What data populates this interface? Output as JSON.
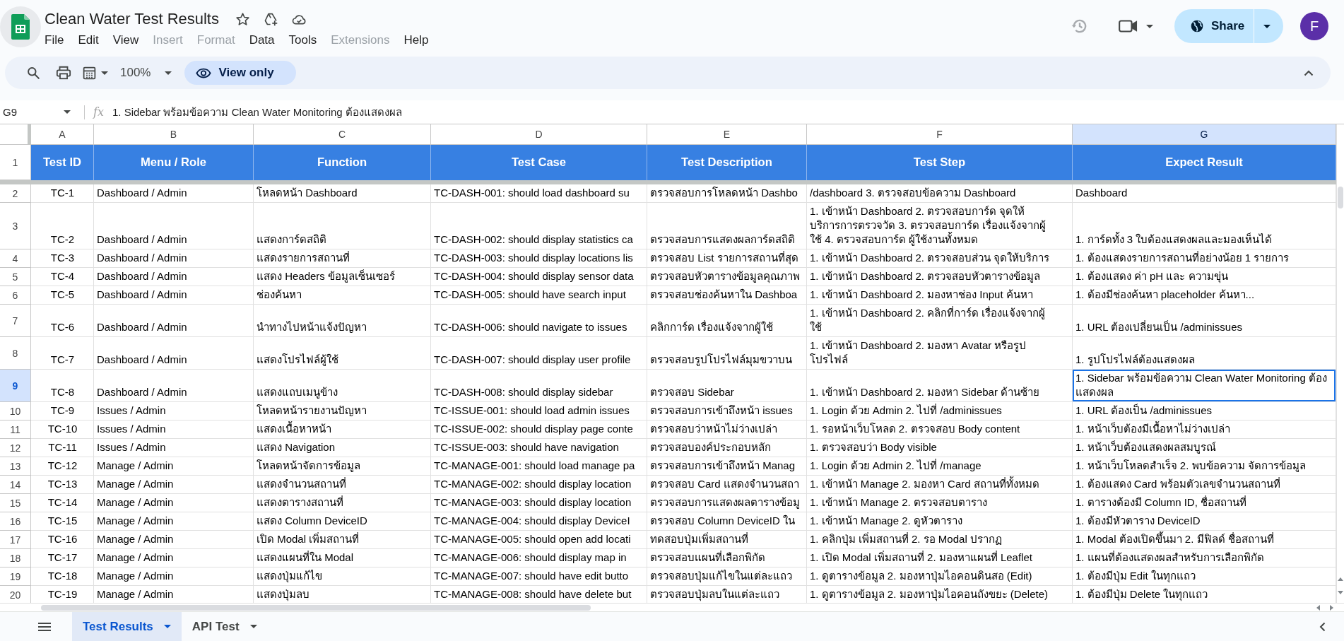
{
  "document": {
    "title": "Clean Water Test Results"
  },
  "menu": [
    {
      "label": "File",
      "disabled": false
    },
    {
      "label": "Edit",
      "disabled": false
    },
    {
      "label": "View",
      "disabled": false
    },
    {
      "label": "Insert",
      "disabled": true
    },
    {
      "label": "Format",
      "disabled": true
    },
    {
      "label": "Data",
      "disabled": false
    },
    {
      "label": "Tools",
      "disabled": false
    },
    {
      "label": "Extensions",
      "disabled": true
    },
    {
      "label": "Help",
      "disabled": false
    }
  ],
  "account": {
    "share_label": "Share",
    "avatar_initial": "F"
  },
  "toolbar": {
    "zoom": "100%",
    "mode": "View only"
  },
  "formula_bar": {
    "cell_ref": "G9",
    "fx": "fx",
    "content": "1. Sidebar พร้อมข้อความ Clean Water Monitoring ต้องแสดงผล"
  },
  "sheet": {
    "column_letters": [
      {
        "label": "A",
        "selected": false
      },
      {
        "label": "B",
        "selected": false
      },
      {
        "label": "C",
        "selected": false
      },
      {
        "label": "D",
        "selected": false
      },
      {
        "label": "E",
        "selected": false
      },
      {
        "label": "F",
        "selected": false
      },
      {
        "label": "G",
        "selected": true
      }
    ],
    "header_row": {
      "number": "1",
      "cells": [
        "Test ID",
        "Menu / Role",
        "Function",
        "Test Case",
        "Test Description",
        "Test Step",
        "Expect Result"
      ]
    },
    "rows": [
      {
        "number": "2",
        "selected": false,
        "cells": [
          {
            "text": "TC-1",
            "selected": false
          },
          {
            "text": "Dashboard / Admin",
            "selected": false
          },
          {
            "text": "โหลดหน้า Dashboard",
            "selected": false
          },
          {
            "text": "TC-DASH-001: should load dashboard su",
            "selected": false
          },
          {
            "text": "ตรวจสอบการโหลดหน้า Dashbo",
            "selected": false
          },
          {
            "text": "/dashboard 3. ตรวจสอบข้อความ Dashboard",
            "selected": false
          },
          {
            "text": "Dashboard",
            "selected": false
          }
        ]
      },
      {
        "number": "3",
        "selected": false,
        "cells": [
          {
            "text": "TC-2",
            "selected": false
          },
          {
            "text": "Dashboard / Admin",
            "selected": false
          },
          {
            "text": "แสดงการ์ดสถิติ",
            "selected": false
          },
          {
            "text": "TC-DASH-002: should display statistics ca",
            "selected": false
          },
          {
            "text": "ตรวจสอบการแสดงผลการ์ดสถิติ",
            "selected": false
          },
          {
            "text": "1. เข้าหน้า Dashboard 2. ตรวจสอบการ์ด จุดให้บริการการตรวจวัด 3. ตรวจสอบการ์ด เรื่องแจ้งจากผู้ใช้ 4. ตรวจสอบการ์ด ผู้ใช้งานทั้งหมด",
            "selected": false
          },
          {
            "text": "1. การ์ดทั้ง 3 ใบต้องแสดงผลและมองเห็นได้",
            "selected": false
          }
        ]
      },
      {
        "number": "4",
        "selected": false,
        "cells": [
          {
            "text": "TC-3",
            "selected": false
          },
          {
            "text": "Dashboard / Admin",
            "selected": false
          },
          {
            "text": "แสดงรายการสถานที่",
            "selected": false
          },
          {
            "text": "TC-DASH-003: should display locations lis",
            "selected": false
          },
          {
            "text": "ตรวจสอบ List รายการสถานที่สุด",
            "selected": false
          },
          {
            "text": "1. เข้าหน้า Dashboard 2. ตรวจสอบส่วน จุดให้บริการ",
            "selected": false
          },
          {
            "text": "1. ต้องแสดงรายการสถานที่อย่างน้อย 1 รายการ",
            "selected": false
          }
        ]
      },
      {
        "number": "5",
        "selected": false,
        "cells": [
          {
            "text": "TC-4",
            "selected": false
          },
          {
            "text": "Dashboard / Admin",
            "selected": false
          },
          {
            "text": "แสดง Headers ข้อมูลเซ็นเซอร์",
            "selected": false
          },
          {
            "text": "TC-DASH-004: should display sensor data",
            "selected": false
          },
          {
            "text": "ตรวจสอบหัวตารางข้อมูลคุณภาพ",
            "selected": false
          },
          {
            "text": "1. เข้าหน้า Dashboard 2. ตรวจสอบหัวตารางข้อมูล",
            "selected": false
          },
          {
            "text": "1. ต้องแสดง ค่า pH และ ความขุ่น",
            "selected": false
          }
        ]
      },
      {
        "number": "6",
        "selected": false,
        "cells": [
          {
            "text": "TC-5",
            "selected": false
          },
          {
            "text": "Dashboard / Admin",
            "selected": false
          },
          {
            "text": "ช่องค้นหา",
            "selected": false
          },
          {
            "text": "TC-DASH-005: should have search input",
            "selected": false
          },
          {
            "text": "ตรวจสอบช่องค้นหาใน Dashboa",
            "selected": false
          },
          {
            "text": "1. เข้าหน้า Dashboard 2. มองหาช่อง Input ค้นหา",
            "selected": false
          },
          {
            "text": "1. ต้องมีช่องค้นหา placeholder ค้นหา...",
            "selected": false
          }
        ]
      },
      {
        "number": "7",
        "selected": false,
        "cells": [
          {
            "text": "TC-6",
            "selected": false
          },
          {
            "text": "Dashboard / Admin",
            "selected": false
          },
          {
            "text": "นำทางไปหน้าแจ้งปัญหา",
            "selected": false
          },
          {
            "text": "TC-DASH-006: should navigate to issues",
            "selected": false
          },
          {
            "text": "คลิกการ์ด เรื่องแจ้งจากผู้ใช้",
            "selected": false
          },
          {
            "text": "1. เข้าหน้า Dashboard 2. คลิกที่การ์ด เรื่องแจ้งจากผู้ใช้",
            "selected": false
          },
          {
            "text": "1. URL ต้องเปลี่ยนเป็น /adminissues",
            "selected": false
          }
        ]
      },
      {
        "number": "8",
        "selected": false,
        "cells": [
          {
            "text": "TC-7",
            "selected": false
          },
          {
            "text": "Dashboard / Admin",
            "selected": false
          },
          {
            "text": "แสดงโปรไฟล์ผู้ใช้",
            "selected": false
          },
          {
            "text": "TC-DASH-007: should display user profile",
            "selected": false
          },
          {
            "text": "ตรวจสอบรูปโปรไฟล์มุมขวาบน",
            "selected": false
          },
          {
            "text": "1. เข้าหน้า Dashboard 2. มองหา Avatar หรือรูปโปรไฟล์",
            "selected": false
          },
          {
            "text": "1. รูปโปรไฟล์ต้องแสดงผล",
            "selected": false
          }
        ]
      },
      {
        "number": "9",
        "selected": true,
        "cells": [
          {
            "text": "TC-8",
            "selected": false
          },
          {
            "text": "Dashboard / Admin",
            "selected": false
          },
          {
            "text": "แสดงแถบเมนูข้าง",
            "selected": false
          },
          {
            "text": "TC-DASH-008: should display sidebar",
            "selected": false
          },
          {
            "text": "ตรวจสอบ Sidebar",
            "selected": false
          },
          {
            "text": "1. เข้าหน้า Dashboard 2. มองหา Sidebar ด้านซ้าย",
            "selected": false
          },
          {
            "text": "1. Sidebar พร้อมข้อความ Clean Water Monitoring ต้องแสดงผล",
            "selected": true
          }
        ]
      },
      {
        "number": "10",
        "selected": false,
        "cells": [
          {
            "text": "TC-9",
            "selected": false
          },
          {
            "text": "Issues / Admin",
            "selected": false
          },
          {
            "text": "โหลดหน้ารายงานปัญหา",
            "selected": false
          },
          {
            "text": "TC-ISSUE-001: should load admin issues",
            "selected": false
          },
          {
            "text": "ตรวจสอบการเข้าถึงหน้า issues",
            "selected": false
          },
          {
            "text": "1. Login ด้วย Admin 2. ไปที่ /adminissues",
            "selected": false
          },
          {
            "text": "1. URL ต้องเป็น /adminissues",
            "selected": false
          }
        ]
      },
      {
        "number": "11",
        "selected": false,
        "cells": [
          {
            "text": "TC-10",
            "selected": false
          },
          {
            "text": "Issues / Admin",
            "selected": false
          },
          {
            "text": "แสดงเนื้อหาหน้า",
            "selected": false
          },
          {
            "text": "TC-ISSUE-002: should display page conte",
            "selected": false
          },
          {
            "text": "ตรวจสอบว่าหน้าไม่ว่างเปล่า",
            "selected": false
          },
          {
            "text": "1. รอหน้าเว็บโหลด 2. ตรวจสอบ Body content",
            "selected": false
          },
          {
            "text": "1. หน้าเว็บต้องมีเนื้อหาไม่ว่างเปล่า",
            "selected": false
          }
        ]
      },
      {
        "number": "12",
        "selected": false,
        "cells": [
          {
            "text": "TC-11",
            "selected": false
          },
          {
            "text": "Issues / Admin",
            "selected": false
          },
          {
            "text": "แสดง Navigation",
            "selected": false
          },
          {
            "text": "TC-ISSUE-003: should have navigation",
            "selected": false
          },
          {
            "text": "ตรวจสอบองค์ประกอบหลัก",
            "selected": false
          },
          {
            "text": "1. ตรวจสอบว่า Body visible",
            "selected": false
          },
          {
            "text": "1. หน้าเว็บต้องแสดงผลสมบูรณ์",
            "selected": false
          }
        ]
      },
      {
        "number": "13",
        "selected": false,
        "cells": [
          {
            "text": "TC-12",
            "selected": false
          },
          {
            "text": "Manage / Admin",
            "selected": false
          },
          {
            "text": "โหลดหน้าจัดการข้อมูล",
            "selected": false
          },
          {
            "text": "TC-MANAGE-001: should load manage pa",
            "selected": false
          },
          {
            "text": "ตรวจสอบการเข้าถึงหน้า Manag",
            "selected": false
          },
          {
            "text": "1. Login ด้วย Admin 2. ไปที่ /manage",
            "selected": false
          },
          {
            "text": "1. หน้าเว็บโหลดสำเร็จ 2. พบข้อความ จัดการข้อมูล",
            "selected": false
          }
        ]
      },
      {
        "number": "14",
        "selected": false,
        "cells": [
          {
            "text": "TC-13",
            "selected": false
          },
          {
            "text": "Manage / Admin",
            "selected": false
          },
          {
            "text": "แสดงจำนวนสถานที่",
            "selected": false
          },
          {
            "text": "TC-MANAGE-002: should display location",
            "selected": false
          },
          {
            "text": "ตรวจสอบ Card แสดงจำนวนสถา",
            "selected": false
          },
          {
            "text": "1. เข้าหน้า Manage 2. มองหา Card สถานที่ทั้งหมด",
            "selected": false
          },
          {
            "text": "1. ต้องแสดง Card พร้อมตัวเลขจำนวนสถานที่",
            "selected": false
          }
        ]
      },
      {
        "number": "15",
        "selected": false,
        "cells": [
          {
            "text": "TC-14",
            "selected": false
          },
          {
            "text": "Manage / Admin",
            "selected": false
          },
          {
            "text": "แสดงตารางสถานที่",
            "selected": false
          },
          {
            "text": "TC-MANAGE-003: should display location",
            "selected": false
          },
          {
            "text": "ตรวจสอบการแสดงผลตารางข้อมู",
            "selected": false
          },
          {
            "text": "1. เข้าหน้า Manage 2. ตรวจสอบตาราง",
            "selected": false
          },
          {
            "text": "1. ตารางต้องมี Column ID, ชื่อสถานที่",
            "selected": false
          }
        ]
      },
      {
        "number": "16",
        "selected": false,
        "cells": [
          {
            "text": "TC-15",
            "selected": false
          },
          {
            "text": "Manage / Admin",
            "selected": false
          },
          {
            "text": "แสดง Column DeviceID",
            "selected": false
          },
          {
            "text": "TC-MANAGE-004: should display DeviceI",
            "selected": false
          },
          {
            "text": "ตรวจสอบ Column DeviceID ใน",
            "selected": false
          },
          {
            "text": "1. เข้าหน้า Manage 2. ดูหัวตาราง",
            "selected": false
          },
          {
            "text": "1. ต้องมีหัวตาราง DeviceID",
            "selected": false
          }
        ]
      },
      {
        "number": "17",
        "selected": false,
        "cells": [
          {
            "text": "TC-16",
            "selected": false
          },
          {
            "text": "Manage / Admin",
            "selected": false
          },
          {
            "text": "เปิด Modal เพิ่มสถานที่",
            "selected": false
          },
          {
            "text": "TC-MANAGE-005: should open add locati",
            "selected": false
          },
          {
            "text": "ทดสอบปุ่มเพิ่มสถานที่",
            "selected": false
          },
          {
            "text": "1. คลิกปุ่ม เพิ่มสถานที่ 2. รอ Modal ปรากฏ",
            "selected": false
          },
          {
            "text": "1. Modal ต้องเปิดขึ้นมา 2. มีฟิลด์ ชื่อสถานที่",
            "selected": false
          }
        ]
      },
      {
        "number": "18",
        "selected": false,
        "cells": [
          {
            "text": "TC-17",
            "selected": false
          },
          {
            "text": "Manage / Admin",
            "selected": false
          },
          {
            "text": "แสดงแผนที่ใน Modal",
            "selected": false
          },
          {
            "text": "TC-MANAGE-006: should display map in",
            "selected": false
          },
          {
            "text": "ตรวจสอบแผนที่เลือกพิกัด",
            "selected": false
          },
          {
            "text": "1. เปิด Modal เพิ่มสถานที่ 2. มองหาแผนที่ Leaflet",
            "selected": false
          },
          {
            "text": "1. แผนที่ต้องแสดงผลสำหรับการเลือกพิกัด",
            "selected": false
          }
        ]
      },
      {
        "number": "19",
        "selected": false,
        "cells": [
          {
            "text": "TC-18",
            "selected": false
          },
          {
            "text": "Manage / Admin",
            "selected": false
          },
          {
            "text": "แสดงปุ่มแก้ไข",
            "selected": false
          },
          {
            "text": "TC-MANAGE-007: should have edit butto",
            "selected": false
          },
          {
            "text": "ตรวจสอบปุ่มแก้ไขในแต่ละแถว",
            "selected": false
          },
          {
            "text": "1. ดูตารางข้อมูล 2. มองหาปุ่มไอคอนดินสอ (Edit)",
            "selected": false
          },
          {
            "text": "1. ต้องมีปุ่ม Edit ในทุกแถว",
            "selected": false
          }
        ]
      },
      {
        "number": "20",
        "selected": false,
        "cells": [
          {
            "text": "TC-19",
            "selected": false
          },
          {
            "text": "Manage / Admin",
            "selected": false
          },
          {
            "text": "แสดงปุ่มลบ",
            "selected": false
          },
          {
            "text": "TC-MANAGE-008: should have delete but",
            "selected": false
          },
          {
            "text": "ตรวจสอบปุ่มลบในแต่ละแถว",
            "selected": false
          },
          {
            "text": "1. ดูตารางข้อมูล 2. มองหาปุ่มไอคอนถังขยะ (Delete)",
            "selected": false
          },
          {
            "text": "1. ต้องมีปุ่ม Delete ในทุกแถว",
            "selected": false
          }
        ]
      }
    ]
  },
  "sheet_tabs": [
    {
      "label": "Test Results",
      "selected": true
    },
    {
      "label": "API Test",
      "selected": false
    }
  ]
}
